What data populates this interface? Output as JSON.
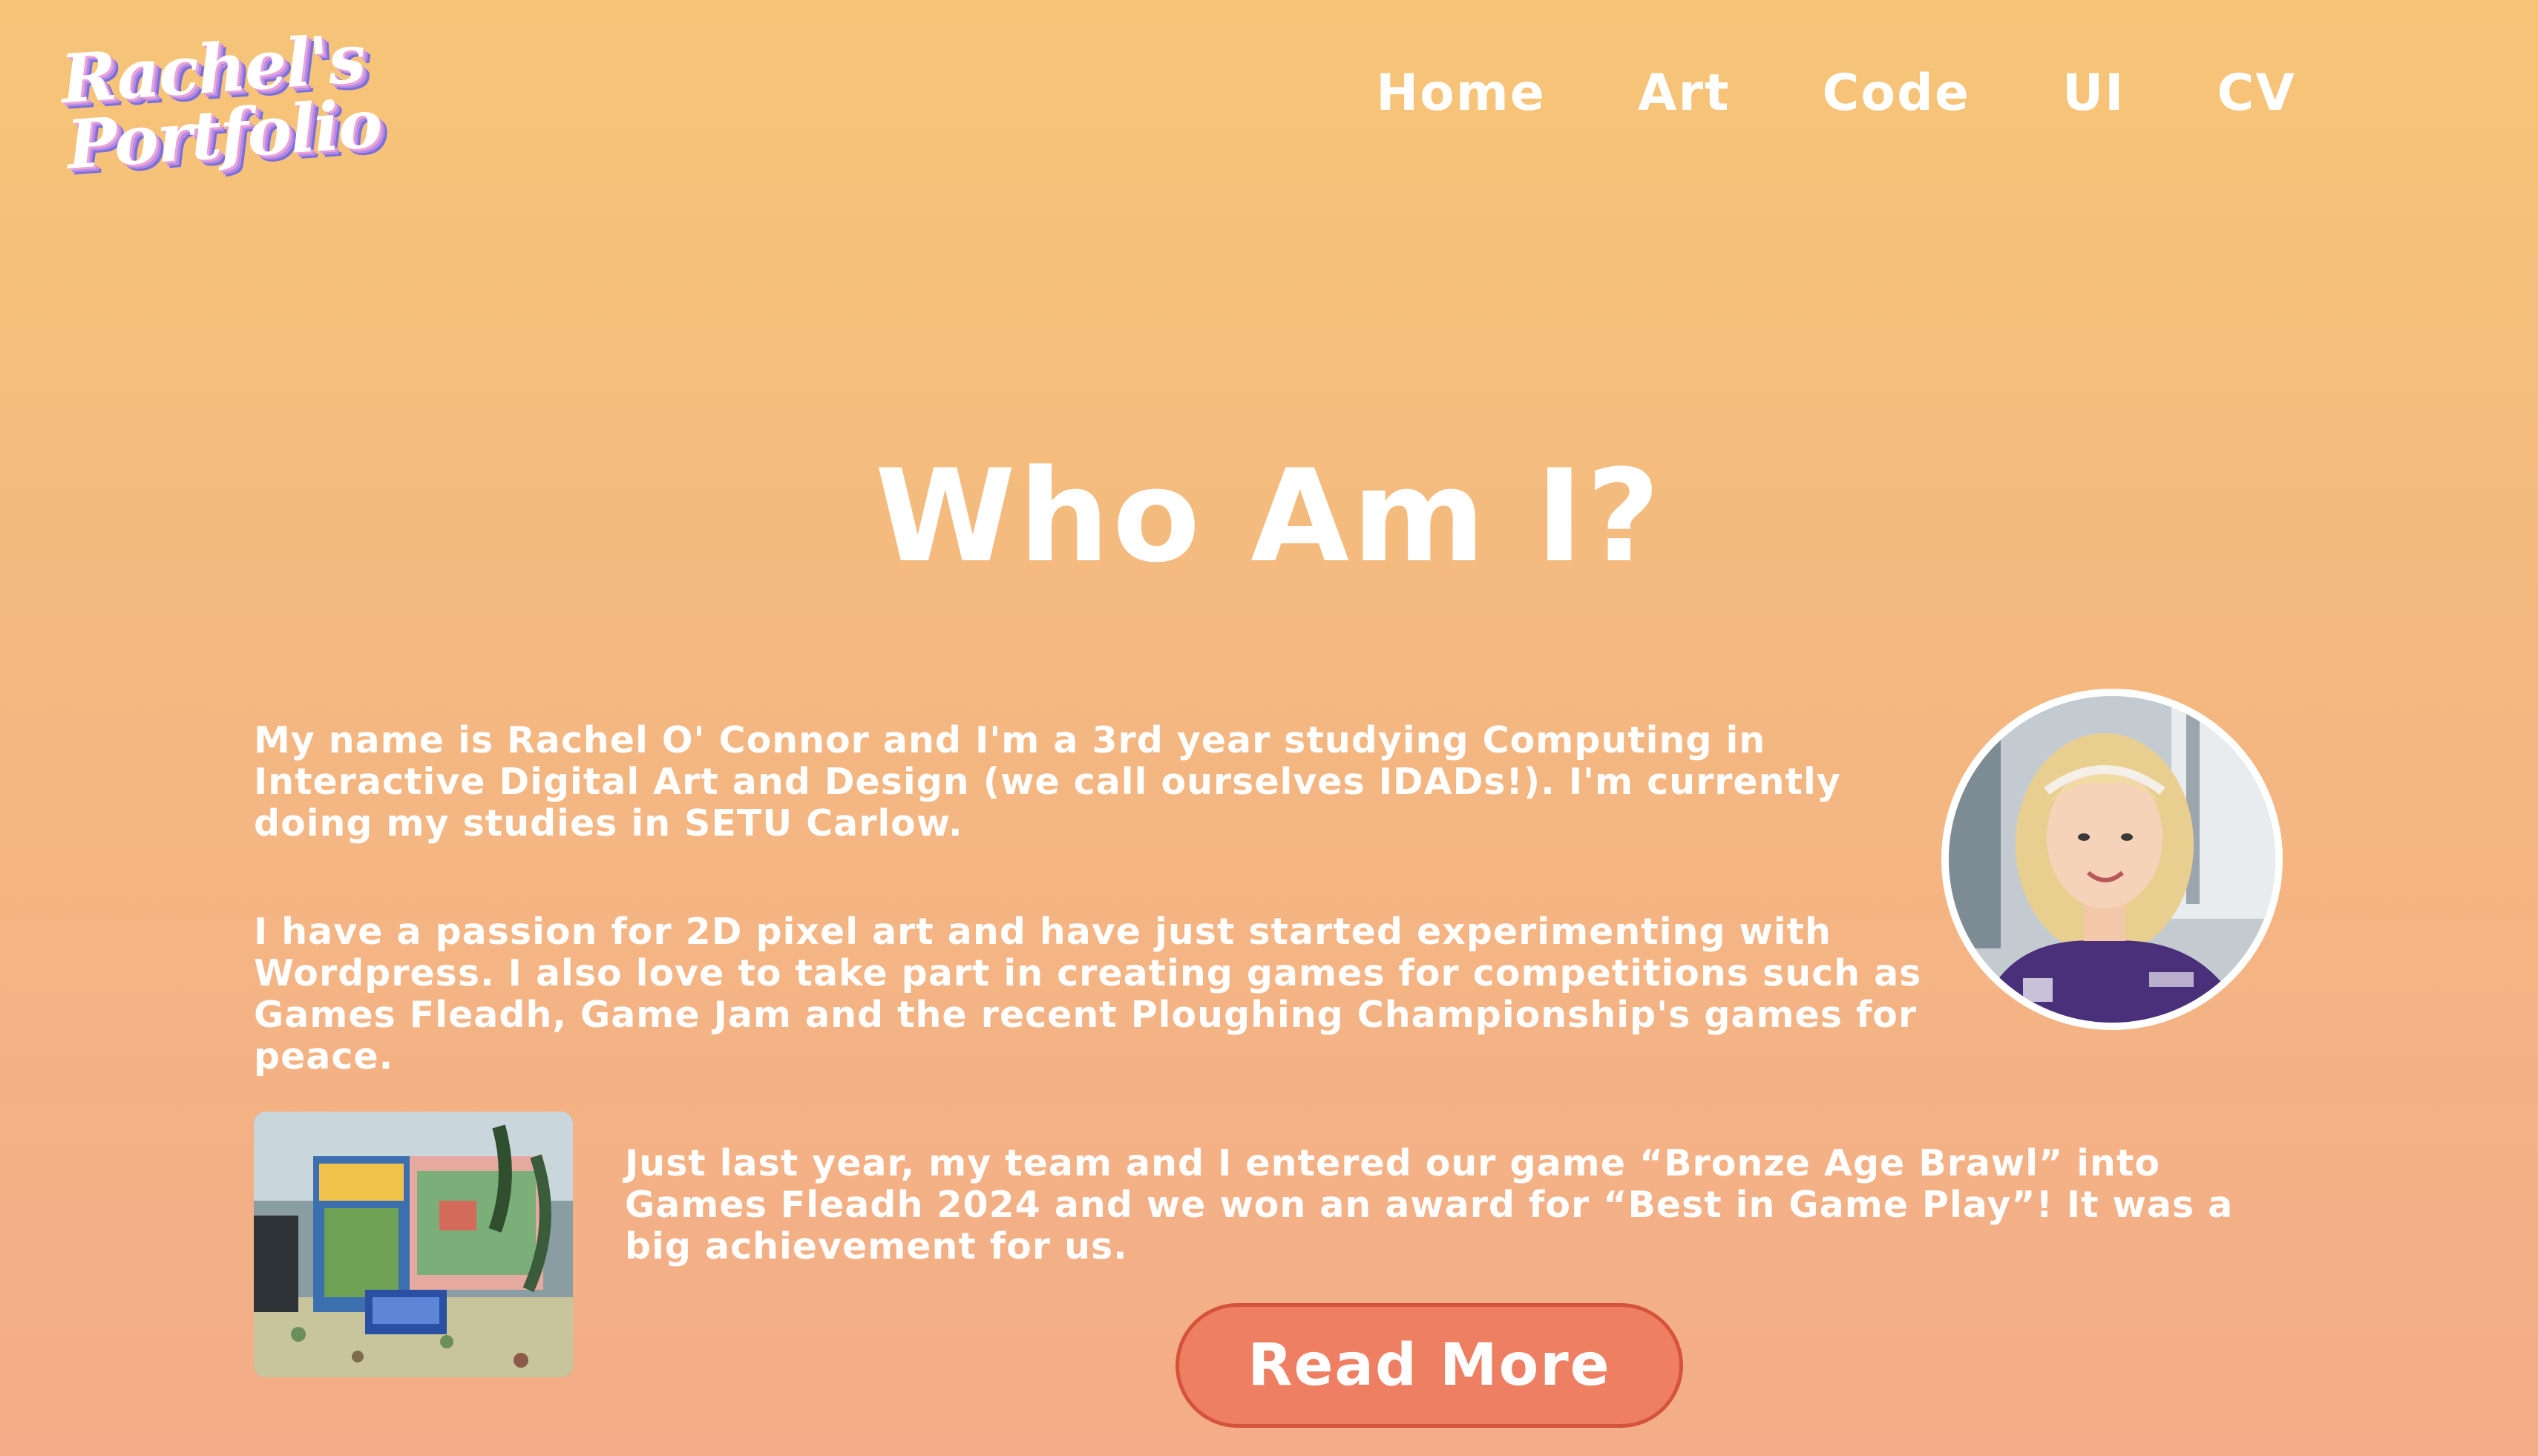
{
  "brand": {
    "line1": "Rachel's",
    "line2": "Portfolio"
  },
  "nav": {
    "items": [
      {
        "label": "Home"
      },
      {
        "label": "Art"
      },
      {
        "label": "Code"
      },
      {
        "label": "UI"
      },
      {
        "label": "CV"
      }
    ]
  },
  "main": {
    "title": "Who Am I?",
    "paragraphs": [
      "My name is Rachel O' Connor and I'm a 3rd year studying Computing in Interactive Digital Art and Design (we call ourselves IDADs!). I'm currently doing my studies in SETU Carlow.",
      "I have a passion for 2D pixel art and have just started experimenting with Wordpress. I also love to take part in creating games for competitions such as Games Fleadh, Game Jam and the recent Ploughing Championship's games for peace.",
      "Just last year, my team and I entered our game “Bronze Age Brawl” into Games Fleadh 2024 and we won an award for “Best in Game Play”! It was a big achievement for us."
    ],
    "read_more_label": "Read More"
  },
  "colors": {
    "background_top": "#f6c577",
    "background_bottom": "#f3ad88",
    "button": "#ee7f62",
    "button_border": "#d5533a",
    "text": "#ffffff"
  }
}
